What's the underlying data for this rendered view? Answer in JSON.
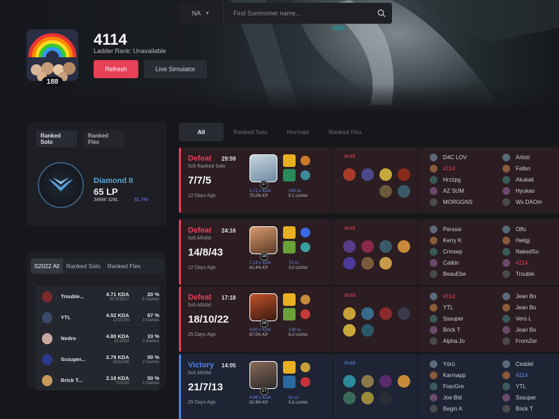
{
  "search": {
    "region": "NA",
    "placeholder": "Find Summoner name..."
  },
  "profile": {
    "name": "4114",
    "ladder_rank": "Ladder Rank: Unavailable",
    "level": "188",
    "refresh_label": "Refresh",
    "live_label": "Live Simulator"
  },
  "ranked": {
    "tabs": [
      "Ranked Solo",
      "Ranked Flex"
    ],
    "tier": "Diamond II",
    "lp": "65 LP",
    "wl": "349W 328L",
    "winrate": "51.7%"
  },
  "season": {
    "tabs": [
      "S2022 All",
      "Ranked Solo",
      "Ranked Flex"
    ],
    "champions": [
      {
        "name": "Trouble...",
        "kda": "4.71 KDA",
        "kda_detail": "30.3/35/17",
        "wr": "20 %",
        "games": "5 Games",
        "color": "#7a2a2a"
      },
      {
        "name": "YTL",
        "kda": "4.52 KDA",
        "kda_detail": "12/21/39",
        "wr": "67 %",
        "games": "3 Games",
        "color": "#3a4a6a"
      },
      {
        "name": "Nedro",
        "kda": "4.80 KDA",
        "kda_detail": "15.3/5/3",
        "wr": "33 %",
        "games": "3 Games",
        "color": "#c8a8a0"
      },
      {
        "name": "Sssuper...",
        "kda": "2.79 KDA",
        "kda_detail": "15/15/38",
        "wr": "50 %",
        "games": "2 Games",
        "color": "#2a3a8a"
      },
      {
        "name": "Brick T...",
        "kda": "2.18 KDA",
        "kda_detail": "7/21/20",
        "wr": "50 %",
        "games": "2 Games",
        "color": "#c89a5a"
      }
    ]
  },
  "match_tabs": [
    "All",
    "Ranked Solo",
    "Normals",
    "Ranked Flex"
  ],
  "matches": [
    {
      "result": "Defeat",
      "duration": "29:59",
      "mode": "5v5 Ranked Solo",
      "kda": "7/7/5",
      "ago": "12 Days Ago",
      "level": "17",
      "kda_ratio": "1.71:1 KDA",
      "kp": "75.0% KP",
      "cs": "149 cs",
      "cs_min": "5.1 cs/min",
      "team1": [
        "D4C LOV",
        "4114",
        "Hrzzpg",
        "AZ SUM",
        "MORGGNS"
      ],
      "team2": [
        "Artisti",
        "Fallsn",
        "Akukali",
        "Hyukao",
        "Wx DAOm"
      ]
    },
    {
      "result": "Defeat",
      "duration": "24:16",
      "mode": "5v5 ARAM",
      "kda": "14/8/43",
      "ago": "12 Days Ago",
      "level": "18",
      "kda_ratio": "7.13:1 KDA",
      "kp": "81.4% KP",
      "cs": "73 cs",
      "cs_min": "3.0 cs/min",
      "team1": [
        "Persssi",
        "Kerry K",
        "Crinsep",
        "Catkin",
        "BeauEbe"
      ],
      "team2": [
        "Olfu",
        "Heilgj",
        "NakedSu",
        "4114",
        "Trouble"
      ]
    },
    {
      "result": "Defeat",
      "duration": "17:18",
      "mode": "5v5 ARAM",
      "kda": "18/10/22",
      "ago": "25 Days Ago",
      "level": "18",
      "kda_ratio": "4.00:1 KDA",
      "kp": "87.0% KP",
      "cs": "108 cs",
      "cs_min": "6.2 cs/min",
      "team1": [
        "4114",
        "YTL",
        "Sssuper",
        "Brick T",
        "Alpha.Jo"
      ],
      "team2": [
        "Jean Bo",
        "Jean Bo",
        "Vers L",
        "Jean Bo",
        "FromZer"
      ]
    },
    {
      "result": "Victory",
      "duration": "14:05",
      "mode": "5v5 ARAM",
      "kda": "21/7/13",
      "ago": "25 Days Ago",
      "level": "17",
      "kda_ratio": "4.86:1 KDA",
      "kp": "82.9% KP",
      "cs": "81 cs",
      "cs_min": "5.8 cs/min",
      "team1": [
        "Yörü",
        "Karmapp",
        "FranGre",
        "Joe Bid",
        "Begin A"
      ],
      "team2": [
        "Ceddel",
        "4114",
        "YTL",
        "Sssuper",
        "Brick T"
      ]
    }
  ],
  "build_label": "Build",
  "colors": {
    "accent_red": "#e84057",
    "accent_blue": "#5383e8",
    "defeat_bg": "#2b1d21",
    "victory_bg": "#1e2433"
  }
}
